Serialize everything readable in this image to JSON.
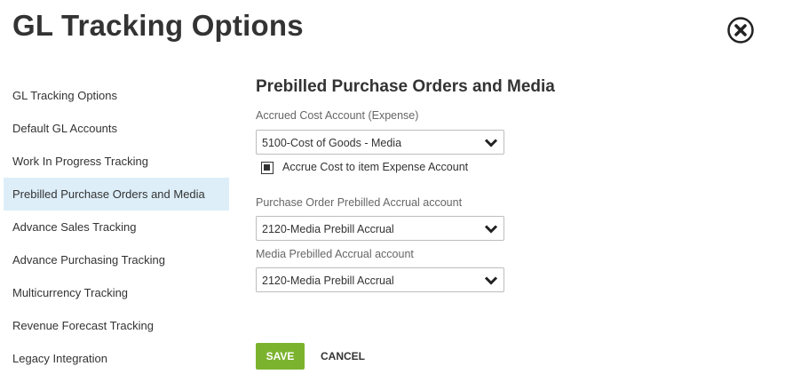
{
  "dialog": {
    "title": "GL Tracking Options"
  },
  "sidebar": {
    "items": [
      {
        "label": "GL Tracking Options"
      },
      {
        "label": "Default GL Accounts"
      },
      {
        "label": "Work In Progress Tracking"
      },
      {
        "label": "Prebilled Purchase Orders and Media",
        "active": true
      },
      {
        "label": "Advance Sales Tracking"
      },
      {
        "label": "Advance Purchasing Tracking"
      },
      {
        "label": "Multicurrency Tracking"
      },
      {
        "label": "Revenue Forecast Tracking"
      },
      {
        "label": "Legacy Integration"
      }
    ]
  },
  "form": {
    "section_title": "Prebilled Purchase Orders and Media",
    "accrued_cost": {
      "label": "Accrued Cost Account (Expense)",
      "value": "5100-Cost of Goods - Media"
    },
    "accrue_checkbox": {
      "label": "Accrue Cost to item Expense Account",
      "checked": true
    },
    "po_prebilled": {
      "label": "Purchase Order Prebilled Accrual account",
      "value": "2120-Media Prebill Accrual"
    },
    "media_prebilled": {
      "label": "Media Prebilled Accrual account",
      "value": "2120-Media Prebill Accrual"
    },
    "save_label": "SAVE",
    "cancel_label": "CANCEL"
  },
  "colors": {
    "active_item_bg": "#ddeef9",
    "save_button": "#7cb32e"
  },
  "icons": {
    "close": "close-circle-icon",
    "dropdown": "chevron-down-icon"
  }
}
